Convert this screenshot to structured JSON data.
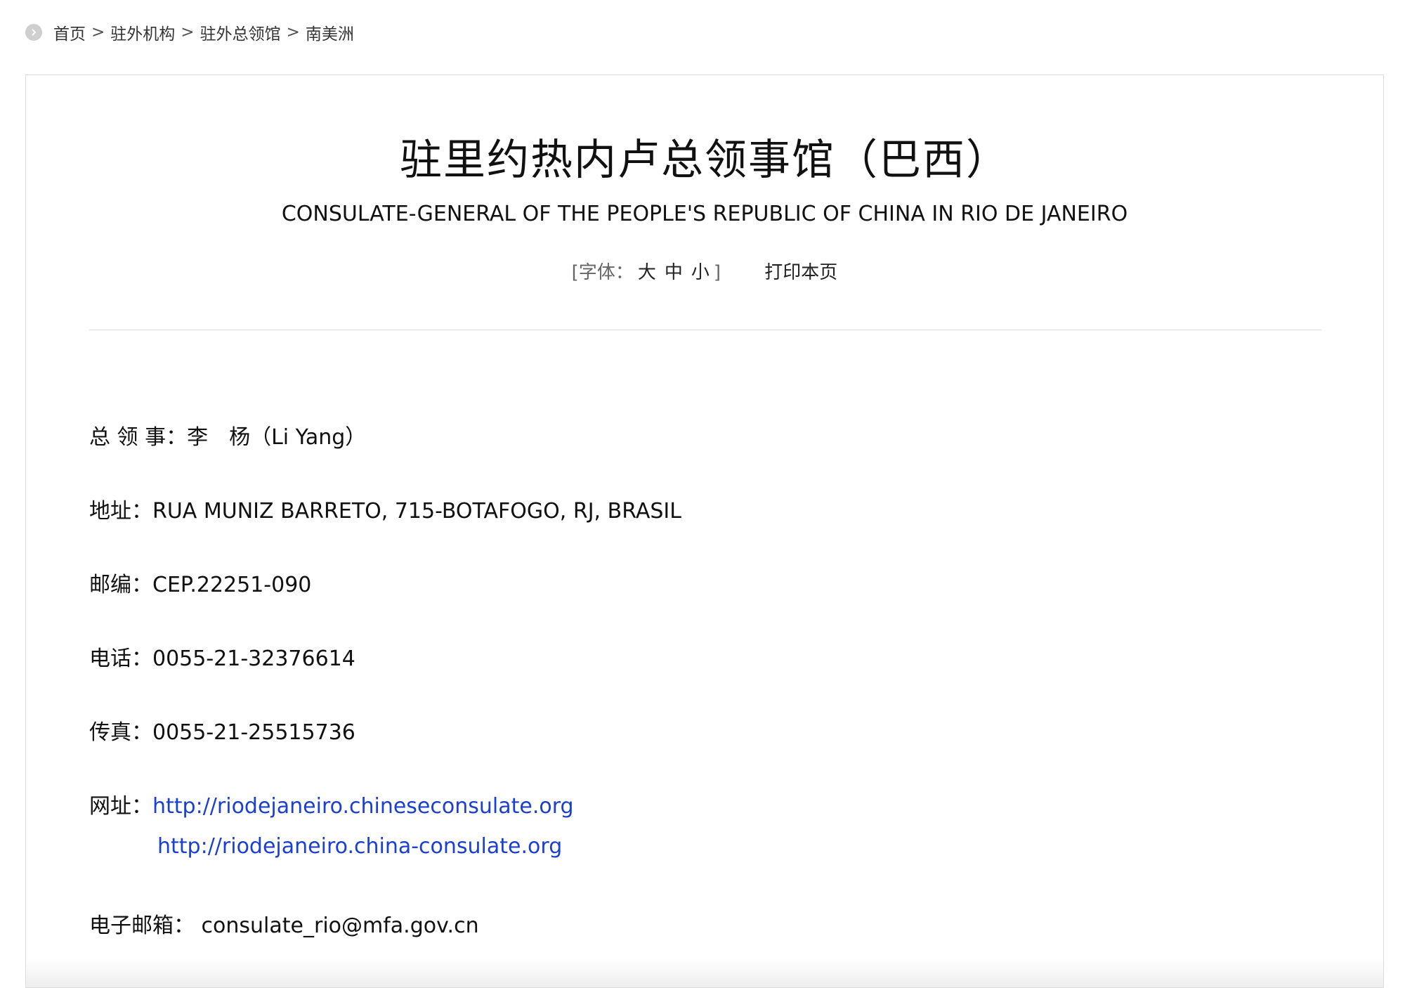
{
  "breadcrumb": {
    "home": "首页",
    "sep": ">",
    "level1": "驻外机构",
    "level2": "驻外总领馆",
    "level3": "南美洲"
  },
  "title": {
    "cn": "驻里约热内卢总领事馆（巴西）",
    "en": "CONSULATE-GENERAL OF THE PEOPLE'S REPUBLIC OF CHINA IN RIO DE JANEIRO"
  },
  "tools": {
    "font_open": "[字体：",
    "font_large": "大",
    "font_medium": "中",
    "font_small": "小",
    "font_close": "]",
    "print": "打印本页"
  },
  "info": {
    "consul_label": "总 领 事：",
    "consul_value": "李　杨（Li Yang）",
    "address_label": "地址：",
    "address_value": "RUA MUNIZ BARRETO, 715-BOTAFOGO, RJ, BRASIL",
    "postcode_label": "邮编：",
    "postcode_value": "CEP.22251-090",
    "phone_label": "电话：",
    "phone_value": "0055-21-32376614",
    "fax_label": "传真：",
    "fax_value": "0055-21-25515736",
    "website_label": "网址：",
    "website_1": "http://riodejaneiro.chineseconsulate.org",
    "website_2": "http://riodejaneiro.china-consulate.org",
    "email_label": "电子邮箱：",
    "email_value": "consulate_rio@mfa.gov.cn"
  },
  "colors": {
    "link": "#1a3fd1",
    "border": "#dcdcdc"
  }
}
